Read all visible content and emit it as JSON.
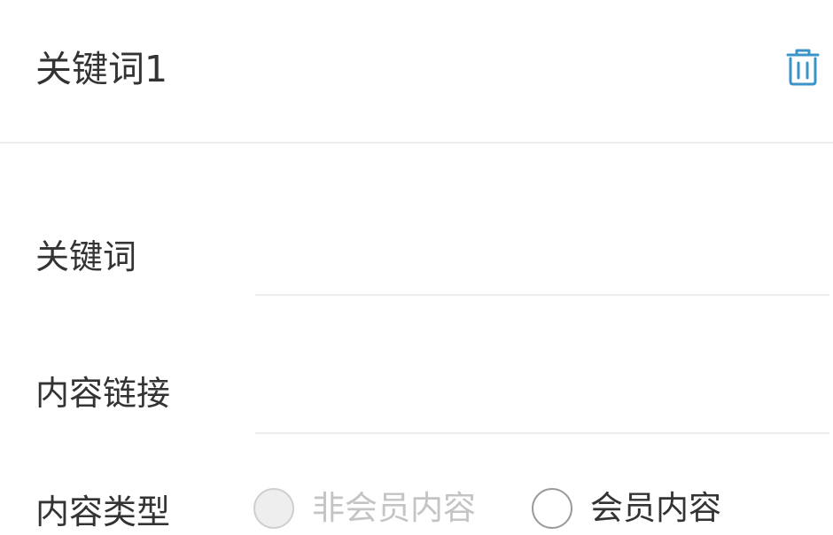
{
  "header": {
    "title": "关键词1",
    "delete_icon": "trash-icon",
    "accent_color": "#3a93c9"
  },
  "form": {
    "keyword": {
      "label": "关键词",
      "value": "",
      "placeholder": ""
    },
    "content_link": {
      "label": "内容链接",
      "value": "",
      "placeholder": ""
    },
    "content_type": {
      "label": "内容类型",
      "options": [
        {
          "label": "非会员内容",
          "state": "disabled"
        },
        {
          "label": "会员内容",
          "state": "enabled"
        }
      ]
    }
  }
}
